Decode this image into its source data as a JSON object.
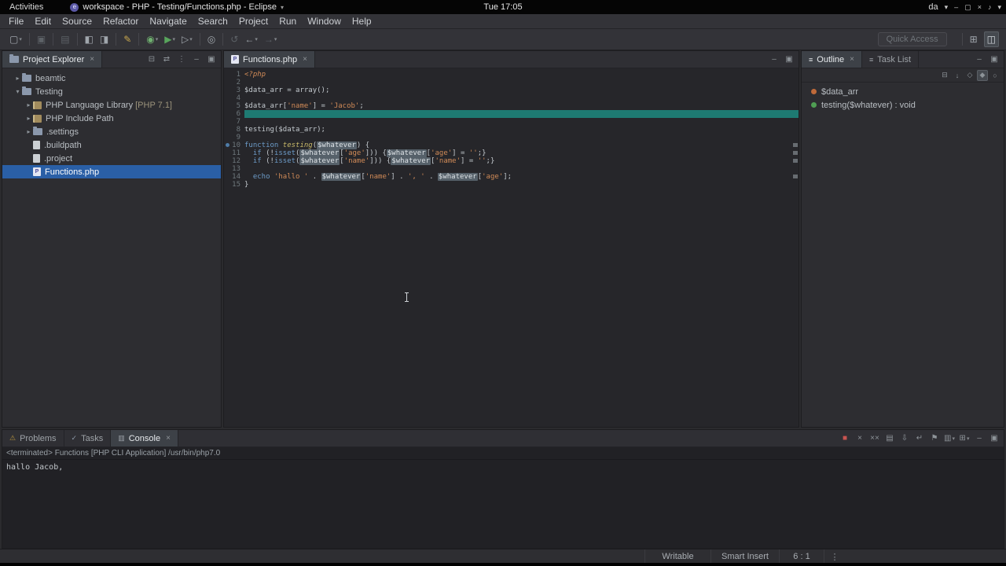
{
  "system_bar": {
    "activities_label": "Activities",
    "window_title": "workspace - PHP - Testing/Functions.php - Eclipse",
    "clock": "Tue 17:05",
    "keyboard_layout": "da",
    "icons": [
      {
        "name": "input-menu-chevron-icon",
        "glyph": "▾"
      },
      {
        "name": "window-minimize-icon",
        "glyph": "–"
      },
      {
        "name": "window-maximize-icon",
        "glyph": "▢"
      },
      {
        "name": "window-close-icon",
        "glyph": "×"
      },
      {
        "name": "volume-icon",
        "glyph": "♪"
      },
      {
        "name": "system-menu-chevron-icon",
        "glyph": "▾"
      }
    ]
  },
  "menu_bar": {
    "items": [
      "File",
      "Edit",
      "Source",
      "Refactor",
      "Navigate",
      "Search",
      "Project",
      "Run",
      "Window",
      "Help"
    ]
  },
  "toolbar": {
    "quick_access_label": "Quick Access",
    "groups": [
      [
        {
          "name": "new-wizard-icon",
          "glyph": "▢",
          "caret": true
        }
      ],
      [
        {
          "name": "save-icon",
          "glyph": "▣",
          "dim": true
        }
      ],
      [
        {
          "name": "print-icon",
          "glyph": "▤",
          "dim": true
        }
      ],
      [
        {
          "name": "new-php-project-icon",
          "glyph": "◧"
        },
        {
          "name": "new-php-file-icon",
          "glyph": "◨"
        }
      ],
      [
        {
          "name": "format-icon",
          "glyph": "✎",
          "color": "#c9a84e"
        }
      ],
      [
        {
          "name": "debug-icon",
          "glyph": "◉",
          "color": "#6faf6f",
          "caret": true
        },
        {
          "name": "run-icon",
          "glyph": "▶",
          "color": "#58a55c",
          "caret": true
        },
        {
          "name": "external-tools-icon",
          "glyph": "▷",
          "caret": true
        }
      ],
      [
        {
          "name": "search-icon",
          "glyph": "◎"
        }
      ],
      [
        {
          "name": "last-edit-location-icon",
          "glyph": "↺",
          "dim": true
        },
        {
          "name": "back-icon",
          "glyph": "←",
          "caret": true
        },
        {
          "name": "forward-icon",
          "glyph": "→",
          "dim": true,
          "caret": true
        }
      ]
    ],
    "right_icons": [
      {
        "name": "open-perspective-icon",
        "glyph": "⊞"
      },
      {
        "name": "php-perspective-icon",
        "glyph": "◫",
        "active": true
      }
    ]
  },
  "explorer": {
    "title": "Project Explorer",
    "header_icons": [
      {
        "name": "collapse-all-icon",
        "glyph": "⊟"
      },
      {
        "name": "link-with-editor-icon",
        "glyph": "⇄"
      },
      {
        "name": "view-menu-icon",
        "glyph": "⋮"
      },
      {
        "name": "minimize-icon",
        "glyph": "–"
      },
      {
        "name": "maximize-icon",
        "glyph": "▣"
      }
    ],
    "items": [
      {
        "label": "beamtic",
        "icon": "project",
        "level": 0,
        "caret": "col"
      },
      {
        "label": "Testing",
        "icon": "project",
        "level": 0,
        "caret": "exp"
      },
      {
        "label": "PHP Language Library",
        "detail": "[PHP 7.1]",
        "icon": "library",
        "level": 1,
        "caret": "col"
      },
      {
        "label": "PHP Include Path",
        "icon": "library",
        "level": 1,
        "caret": "col"
      },
      {
        "label": ".settings",
        "icon": "folder",
        "level": 1,
        "caret": "col"
      },
      {
        "label": ".buildpath",
        "icon": "file",
        "level": 1,
        "caret": "none"
      },
      {
        "label": ".project",
        "icon": "file",
        "level": 1,
        "caret": "none"
      },
      {
        "label": "Functions.php",
        "icon": "php",
        "level": 1,
        "caret": "none",
        "selected": true
      }
    ]
  },
  "editor": {
    "tab_label": "Functions.php",
    "panel_icons": [
      {
        "name": "minimize-icon",
        "glyph": "–"
      },
      {
        "name": "maximize-icon",
        "glyph": "▣"
      }
    ],
    "marks": [
      10,
      11,
      12,
      14
    ],
    "lines": [
      {
        "n": 1,
        "tokens": [
          [
            "tag",
            "<?php"
          ]
        ]
      },
      {
        "n": 2,
        "tokens": []
      },
      {
        "n": 3,
        "tokens": [
          [
            "var",
            "$data_arr"
          ],
          [
            "pl",
            " = array();"
          ]
        ]
      },
      {
        "n": 4,
        "tokens": []
      },
      {
        "n": 5,
        "tokens": [
          [
            "var",
            "$data_arr"
          ],
          [
            "pl",
            "["
          ],
          [
            "str",
            "'name'"
          ],
          [
            "pl",
            "] = "
          ],
          [
            "str",
            "'Jacob'"
          ],
          [
            "pl",
            ";"
          ]
        ]
      },
      {
        "n": 6,
        "tokens": [],
        "selected": true
      },
      {
        "n": 7,
        "tokens": []
      },
      {
        "n": 8,
        "tokens": [
          [
            "pl",
            "testing("
          ],
          [
            "var",
            "$data_arr"
          ],
          [
            "pl",
            ");"
          ]
        ]
      },
      {
        "n": 9,
        "tokens": []
      },
      {
        "n": 10,
        "marker": true,
        "tokens": [
          [
            "kw",
            "function "
          ],
          [
            "fn",
            "testing"
          ],
          [
            "pl",
            "("
          ],
          [
            "occ",
            "$whatever"
          ],
          [
            "pl",
            ") {"
          ]
        ]
      },
      {
        "n": 11,
        "tokens": [
          [
            "pl",
            "  "
          ],
          [
            "kw",
            "if"
          ],
          [
            "pl",
            " (!"
          ],
          [
            "kw",
            "isset"
          ],
          [
            "pl",
            "("
          ],
          [
            "occ",
            "$whatever"
          ],
          [
            "pl",
            "["
          ],
          [
            "str",
            "'age'"
          ],
          [
            "pl",
            "])) {"
          ],
          [
            "occ",
            "$whatever"
          ],
          [
            "pl",
            "["
          ],
          [
            "str",
            "'age'"
          ],
          [
            "pl",
            "] = "
          ],
          [
            "str",
            "''"
          ],
          [
            "pl",
            ";}"
          ]
        ]
      },
      {
        "n": 12,
        "tokens": [
          [
            "pl",
            "  "
          ],
          [
            "kw",
            "if"
          ],
          [
            "pl",
            " (!"
          ],
          [
            "kw",
            "isset"
          ],
          [
            "pl",
            "("
          ],
          [
            "occ",
            "$whatever"
          ],
          [
            "pl",
            "["
          ],
          [
            "str",
            "'name'"
          ],
          [
            "pl",
            "])) {"
          ],
          [
            "occ",
            "$whatever"
          ],
          [
            "pl",
            "["
          ],
          [
            "str",
            "'name'"
          ],
          [
            "pl",
            "] = "
          ],
          [
            "str",
            "''"
          ],
          [
            "pl",
            ";}"
          ]
        ]
      },
      {
        "n": 13,
        "tokens": []
      },
      {
        "n": 14,
        "tokens": [
          [
            "pl",
            "  "
          ],
          [
            "kw",
            "echo "
          ],
          [
            "str",
            "'hallo '"
          ],
          [
            "pl",
            " . "
          ],
          [
            "occ",
            "$whatever"
          ],
          [
            "pl",
            "["
          ],
          [
            "str",
            "'name'"
          ],
          [
            "pl",
            "] . "
          ],
          [
            "str",
            "', '"
          ],
          [
            "pl",
            " . "
          ],
          [
            "occ",
            "$whatever"
          ],
          [
            "pl",
            "["
          ],
          [
            "str",
            "'age'"
          ],
          [
            "pl",
            "];"
          ]
        ]
      },
      {
        "n": 15,
        "tokens": [
          [
            "pl",
            "}"
          ]
        ]
      }
    ]
  },
  "outline": {
    "tabs": [
      {
        "label": "Outline",
        "active": true,
        "closable": true
      },
      {
        "label": "Task List",
        "active": false
      }
    ],
    "panel_icons": [
      {
        "name": "minimize-icon",
        "glyph": "–"
      },
      {
        "name": "maximize-icon",
        "glyph": "▣"
      }
    ],
    "toolbar_icons": [
      {
        "name": "collapse-all-icon",
        "glyph": "⊟"
      },
      {
        "name": "sort-icon",
        "glyph": "↓"
      },
      {
        "name": "hide-fields-icon",
        "glyph": "◇"
      },
      {
        "name": "hide-static-members-icon",
        "glyph": "◆",
        "active": true
      },
      {
        "name": "hide-non-public-members-icon",
        "glyph": "○"
      }
    ],
    "items": [
      {
        "icon": "field",
        "label": "$data_arr"
      },
      {
        "icon": "method",
        "label": "testing($whatever) : void"
      }
    ]
  },
  "console": {
    "tabs": [
      {
        "label": "Problems",
        "icon": "problems",
        "active": false
      },
      {
        "label": "Tasks",
        "icon": "tasks",
        "active": false
      },
      {
        "label": "Console",
        "icon": "console",
        "active": true,
        "closable": true
      }
    ],
    "toolbar_icons": [
      {
        "name": "terminate-icon",
        "glyph": "■",
        "color": "#c75450"
      },
      {
        "name": "remove-launch-icon",
        "glyph": "×"
      },
      {
        "name": "remove-all-launches-icon",
        "glyph": "××"
      },
      {
        "name": "clear-console-icon",
        "glyph": "▤"
      },
      {
        "name": "scroll-lock-icon",
        "glyph": "⇩"
      },
      {
        "name": "word-wrap-icon",
        "glyph": "↵"
      },
      {
        "name": "pin-console-icon",
        "glyph": "⚑"
      },
      {
        "name": "display-selected-console-icon",
        "glyph": "▥",
        "caret": true
      },
      {
        "name": "open-console-icon",
        "glyph": "⊞",
        "caret": true
      },
      {
        "name": "minimize-icon",
        "glyph": "–"
      },
      {
        "name": "maximize-icon",
        "glyph": "▣"
      }
    ],
    "header": "<terminated> Functions [PHP CLI Application] /usr/bin/php7.0",
    "output": "hallo Jacob,"
  },
  "status_bar": {
    "writable": "Writable",
    "insert_mode": "Smart Insert",
    "caret_position": "6 : 1",
    "overflow_glyph": "⋮"
  }
}
